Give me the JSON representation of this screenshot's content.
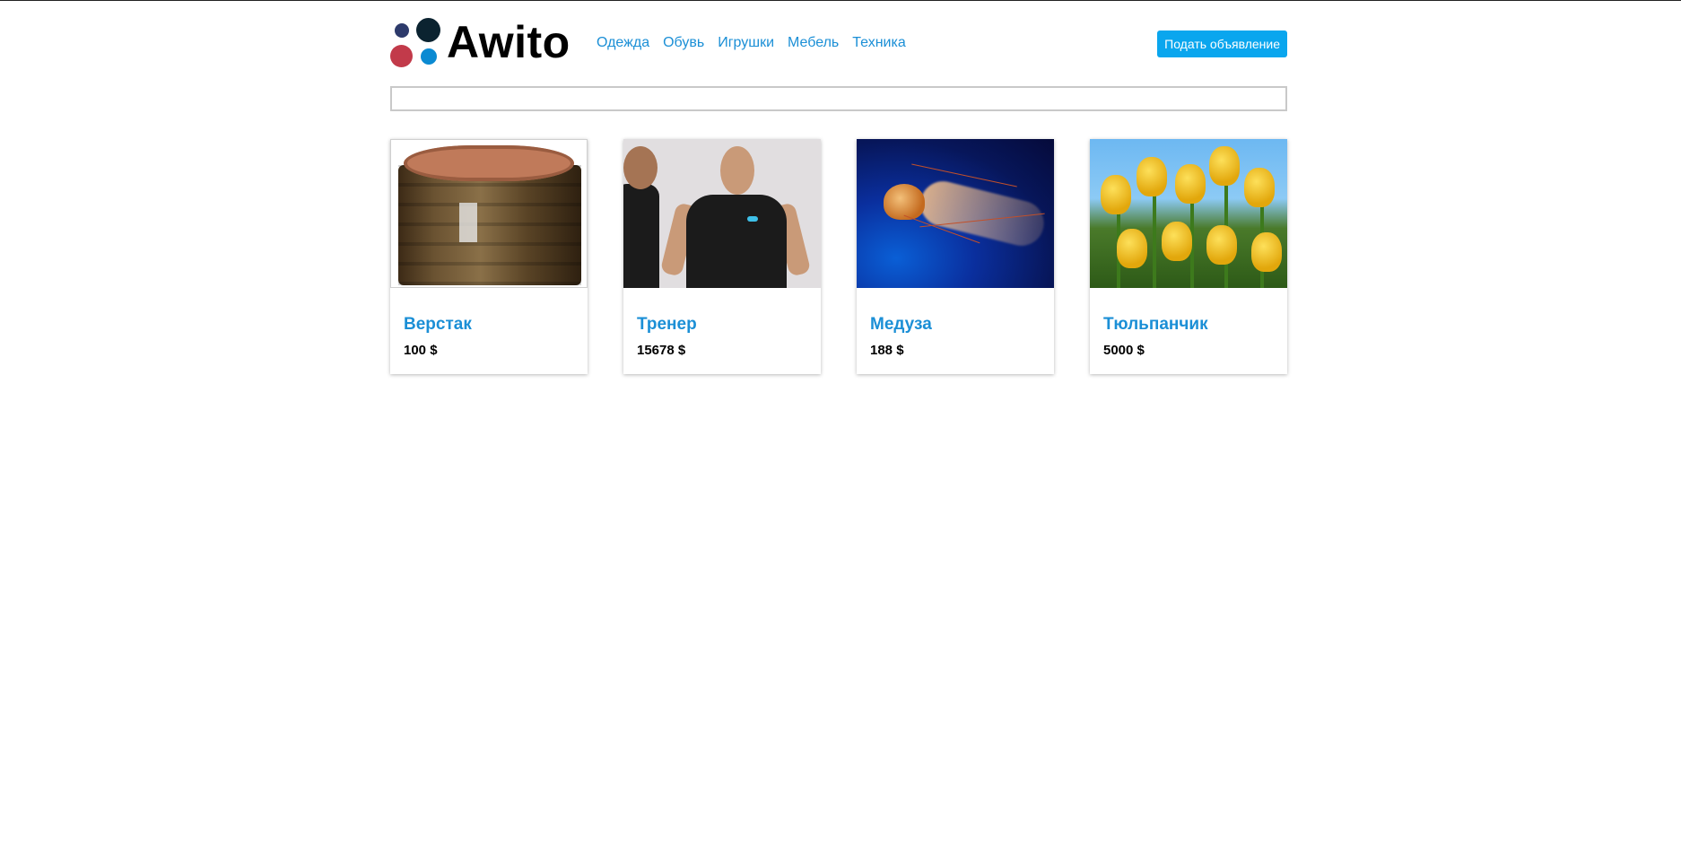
{
  "header": {
    "logo_text": "Awito",
    "nav": [
      "Одежда",
      "Обувь",
      "Игрушки",
      "Мебель",
      "Техника"
    ],
    "post_button": "Подать объявление"
  },
  "search": {
    "value": "",
    "placeholder": ""
  },
  "cards": [
    {
      "title": "Верстак",
      "price": "100 $",
      "image": "crafting-table-image"
    },
    {
      "title": "Тренер",
      "price": "15678 $",
      "image": "trainer-photo"
    },
    {
      "title": "Медуза",
      "price": "188 $",
      "image": "jellyfish-photo"
    },
    {
      "title": "Тюльпанчик",
      "price": "5000 $",
      "image": "tulips-photo"
    }
  ],
  "colors": {
    "link": "#1b8fd6",
    "button": "#0aa6ee",
    "logo_dots": [
      "#2d3a6b",
      "#0b2330",
      "#c23a4a",
      "#0a8ad2"
    ]
  }
}
